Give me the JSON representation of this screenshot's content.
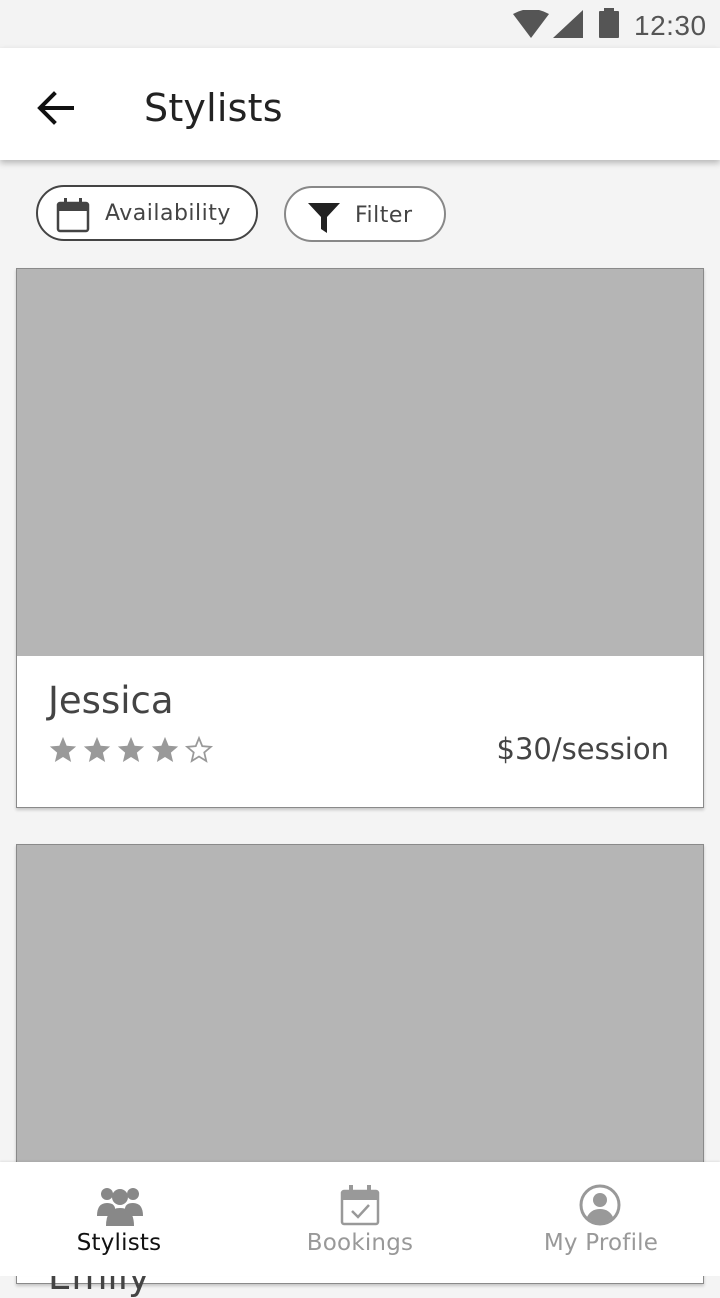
{
  "status_bar": {
    "time": "12:30",
    "icons": [
      "wifi-icon",
      "signal-icon",
      "battery-icon"
    ]
  },
  "app_bar": {
    "title": "Stylists",
    "back_icon": "arrow-left-icon"
  },
  "chips": [
    {
      "label": "Availability",
      "icon": "calendar-icon"
    },
    {
      "label": "Filter",
      "icon": "funnel-icon"
    }
  ],
  "stylists": [
    {
      "name": "Jessica",
      "rating": 4,
      "max_rating": 5,
      "price": "$30/session"
    },
    {
      "name": "Emily"
    }
  ],
  "bottom_nav": {
    "items": [
      {
        "label": "Stylists",
        "icon": "people-icon",
        "active": true
      },
      {
        "label": "Bookings",
        "icon": "calendar-check-icon",
        "active": false
      },
      {
        "label": "My Profile",
        "icon": "account-circle-icon",
        "active": false
      }
    ]
  },
  "colors": {
    "photo_placeholder": "#b5b5b5",
    "text_dark": "#444444",
    "nav_active": "#111111",
    "nav_inactive": "#999999",
    "star": "#999999"
  }
}
